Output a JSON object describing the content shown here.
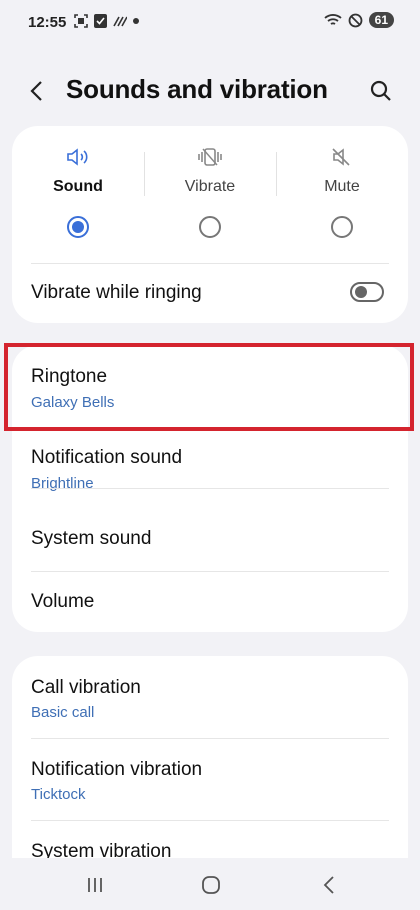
{
  "status_bar": {
    "time": "12:55",
    "battery": "61"
  },
  "header": {
    "title": "Sounds and vibration"
  },
  "modes": [
    {
      "label": "Sound",
      "selected": true
    },
    {
      "label": "Vibrate",
      "selected": false
    },
    {
      "label": "Mute",
      "selected": false
    }
  ],
  "vibrate_while_ringing": {
    "label": "Vibrate while ringing",
    "on": false
  },
  "sounds": {
    "ringtone": {
      "label": "Ringtone",
      "value": "Galaxy Bells"
    },
    "notification_sound": {
      "label": "Notification sound",
      "value": "Brightline"
    },
    "system_sound": {
      "label": "System sound"
    },
    "volume": {
      "label": "Volume"
    }
  },
  "vibrations": {
    "call_vibration": {
      "label": "Call vibration",
      "value": "Basic call"
    },
    "notification_vibration": {
      "label": "Notification vibration",
      "value": "Ticktock"
    },
    "system_vibration": {
      "label": "System vibration"
    }
  },
  "colors": {
    "accent": "#3a6fd8",
    "subtext": "#3f6fb5",
    "highlight": "#d4242e",
    "background": "#f2f2f6"
  }
}
